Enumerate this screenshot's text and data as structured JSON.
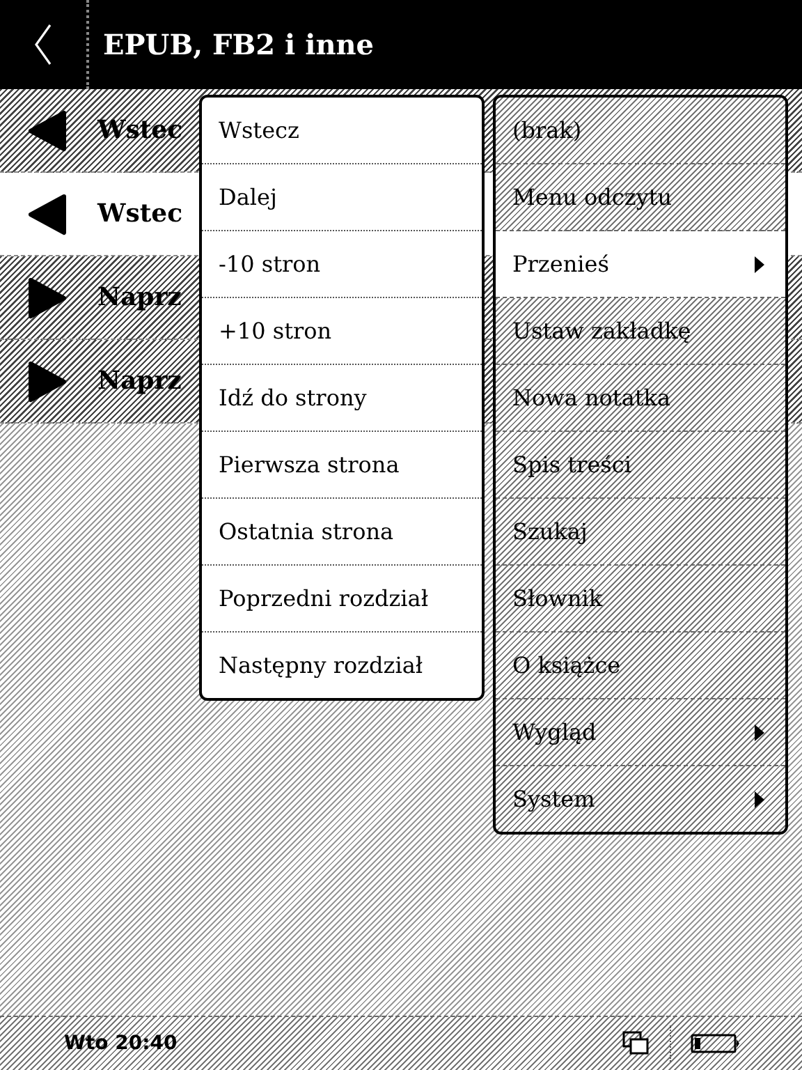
{
  "header": {
    "title": "EPUB, FB2 i inne"
  },
  "list": [
    {
      "label": "Wstec",
      "kind": "back",
      "selected": false
    },
    {
      "label": "Wstec",
      "kind": "back",
      "selected": true
    },
    {
      "label": "Naprz",
      "kind": "forward",
      "selected": false
    },
    {
      "label": "Naprz",
      "kind": "forward",
      "selected": false
    }
  ],
  "popup": {
    "items": [
      "Wstecz",
      "Dalej",
      "-10 stron",
      "+10 stron",
      "Idź do strony",
      "Pierwsza strona",
      "Ostatnia strona",
      "Poprzedni rozdział",
      "Następny rozdział"
    ]
  },
  "menu": {
    "items": [
      {
        "label": "(brak)",
        "selected": false,
        "submenu": false
      },
      {
        "label": "Menu odczytu",
        "selected": false,
        "submenu": false
      },
      {
        "label": "Przenieś",
        "selected": true,
        "submenu": true
      },
      {
        "label": "Ustaw zakładkę",
        "selected": false,
        "submenu": false
      },
      {
        "label": "Nowa notatka",
        "selected": false,
        "submenu": false
      },
      {
        "label": "Spis treści",
        "selected": false,
        "submenu": false
      },
      {
        "label": "Szukaj",
        "selected": false,
        "submenu": false
      },
      {
        "label": "Słownik",
        "selected": false,
        "submenu": false
      },
      {
        "label": "O książce",
        "selected": false,
        "submenu": false
      },
      {
        "label": "Wygląd",
        "selected": false,
        "submenu": true
      },
      {
        "label": "System",
        "selected": false,
        "submenu": true
      }
    ]
  },
  "status_bar": {
    "time": "Wto 20:40"
  }
}
